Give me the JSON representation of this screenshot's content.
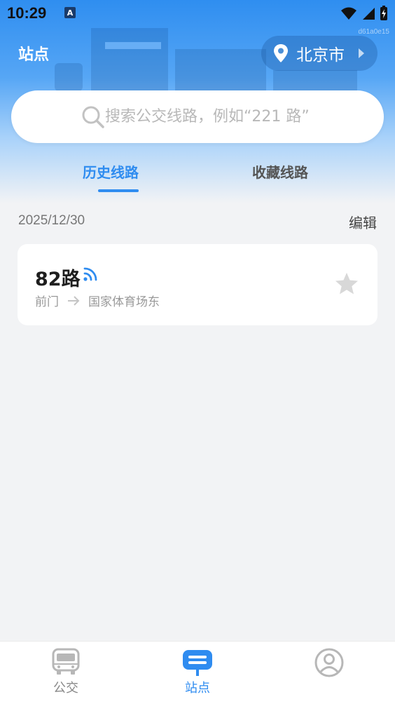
{
  "status_bar": {
    "time": "10:29",
    "notification_badge": "A",
    "watermark": "d61a0e15"
  },
  "header": {
    "title": "站点",
    "city": "北京市"
  },
  "search": {
    "placeholder": "搜索公交线路，例如“221 路”"
  },
  "tabs": [
    {
      "label": "历史线路",
      "active": true
    },
    {
      "label": "收藏线路",
      "active": false
    }
  ],
  "history": {
    "date": "2025/12/30",
    "edit_label": "编辑",
    "routes": [
      {
        "name": "82路",
        "from": "前门",
        "to": "国家体育场东",
        "realtime_icon": "signal-icon",
        "favorited": false
      }
    ]
  },
  "bottom_nav": [
    {
      "label": "公交",
      "icon": "bus-icon",
      "active": false
    },
    {
      "label": "站点",
      "icon": "station-sign-icon",
      "active": true
    },
    {
      "label": "",
      "icon": "profile-icon",
      "active": false
    }
  ],
  "colors": {
    "accent": "#2f8cf0",
    "header_top": "#2f8ef0",
    "background": "#f2f3f5"
  }
}
